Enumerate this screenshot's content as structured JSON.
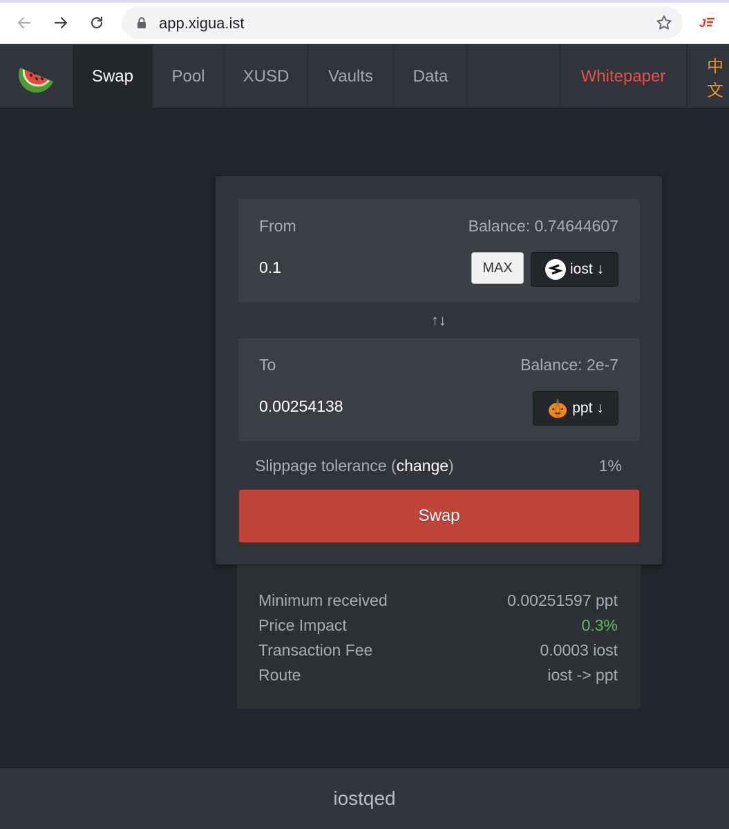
{
  "browser": {
    "url": "app.xigua.ist",
    "icons": [
      "back-arrow-icon",
      "forward-arrow-icon",
      "reload-icon",
      "lock-icon",
      "star-icon",
      "extension-icon"
    ]
  },
  "nav": {
    "logo_icon": "watermelon-icon",
    "items": [
      {
        "label": "Swap",
        "active": true
      },
      {
        "label": "Pool"
      },
      {
        "label": "XUSD"
      },
      {
        "label": "Vaults"
      },
      {
        "label": "Data"
      }
    ],
    "whitepaper": "Whitepaper",
    "lang": "中文",
    "colors": {
      "whitepaper": "#e3524a",
      "lang": "#e8902d"
    }
  },
  "from": {
    "label": "From",
    "balance": "Balance: 0.74644607",
    "amount": "0.1",
    "max": "MAX",
    "token": "iost ↓",
    "token_icon": "iost-logo-icon"
  },
  "switch_arrows": "↑↓",
  "to": {
    "label": "To",
    "balance": "Balance: 2e-7",
    "amount": "0.00254138",
    "token": "ppt ↓",
    "token_icon": "pumpkin-icon"
  },
  "slippage": {
    "label": "Slippage tolerance (",
    "change": "change",
    "close": ")",
    "value": "1%"
  },
  "swap_button": "Swap",
  "swap_color": "#c1443b",
  "details": [
    {
      "label": "Minimum received",
      "value": "0.00251597 ppt"
    },
    {
      "label": "Price Impact",
      "value": "0.3%",
      "color": "#5cbd5c"
    },
    {
      "label": "Transaction Fee",
      "value": "0.0003 iost"
    },
    {
      "label": "Route",
      "value": "iost -> ppt"
    }
  ],
  "footer": "iostqed"
}
